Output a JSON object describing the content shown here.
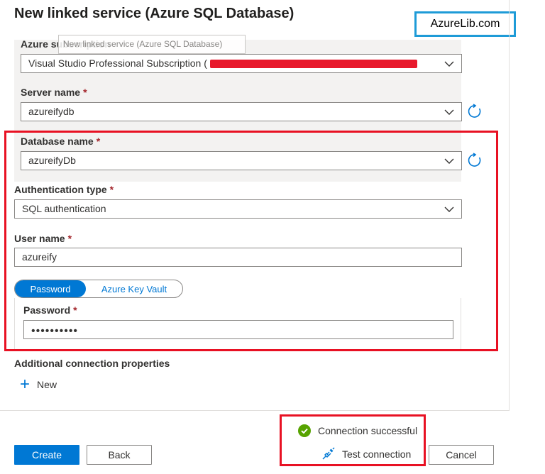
{
  "dialog": {
    "title": "New linked service (Azure SQL Database)"
  },
  "watermark": {
    "text": "AzureLib.com"
  },
  "tooltip": {
    "text": "New linked service (Azure SQL Database)"
  },
  "subscription": {
    "label": "Azure subscription",
    "value": "Visual Studio Professional Subscription ("
  },
  "server": {
    "label": "Server name",
    "required": "*",
    "value": "azureifydb"
  },
  "database": {
    "label": "Database name",
    "required": "*",
    "value": "azureifyDb"
  },
  "auth": {
    "label": "Authentication type",
    "required": "*",
    "value": "SQL authentication"
  },
  "user": {
    "label": "User name",
    "required": "*",
    "value": "azureify"
  },
  "password_toggle": {
    "option_password": "Password",
    "option_keyvault": "Azure Key Vault",
    "selected": "Password"
  },
  "password": {
    "label": "Password",
    "required": "*",
    "value": "••••••••••"
  },
  "additional": {
    "label": "Additional connection properties",
    "new_label": "New"
  },
  "status": {
    "text": "Connection successful"
  },
  "footer": {
    "create": "Create",
    "back": "Back",
    "test_connection": "Test connection",
    "cancel": "Cancel"
  },
  "colors": {
    "accent": "#0078d4",
    "success": "#57a300",
    "annotation_red": "#e81123",
    "watermark_blue": "#1e9bd7"
  },
  "icons": {
    "dropdown": "chevron-down-icon",
    "refresh": "refresh-icon",
    "add": "plus-icon",
    "success": "check-circle-icon",
    "test": "plug-icon"
  }
}
